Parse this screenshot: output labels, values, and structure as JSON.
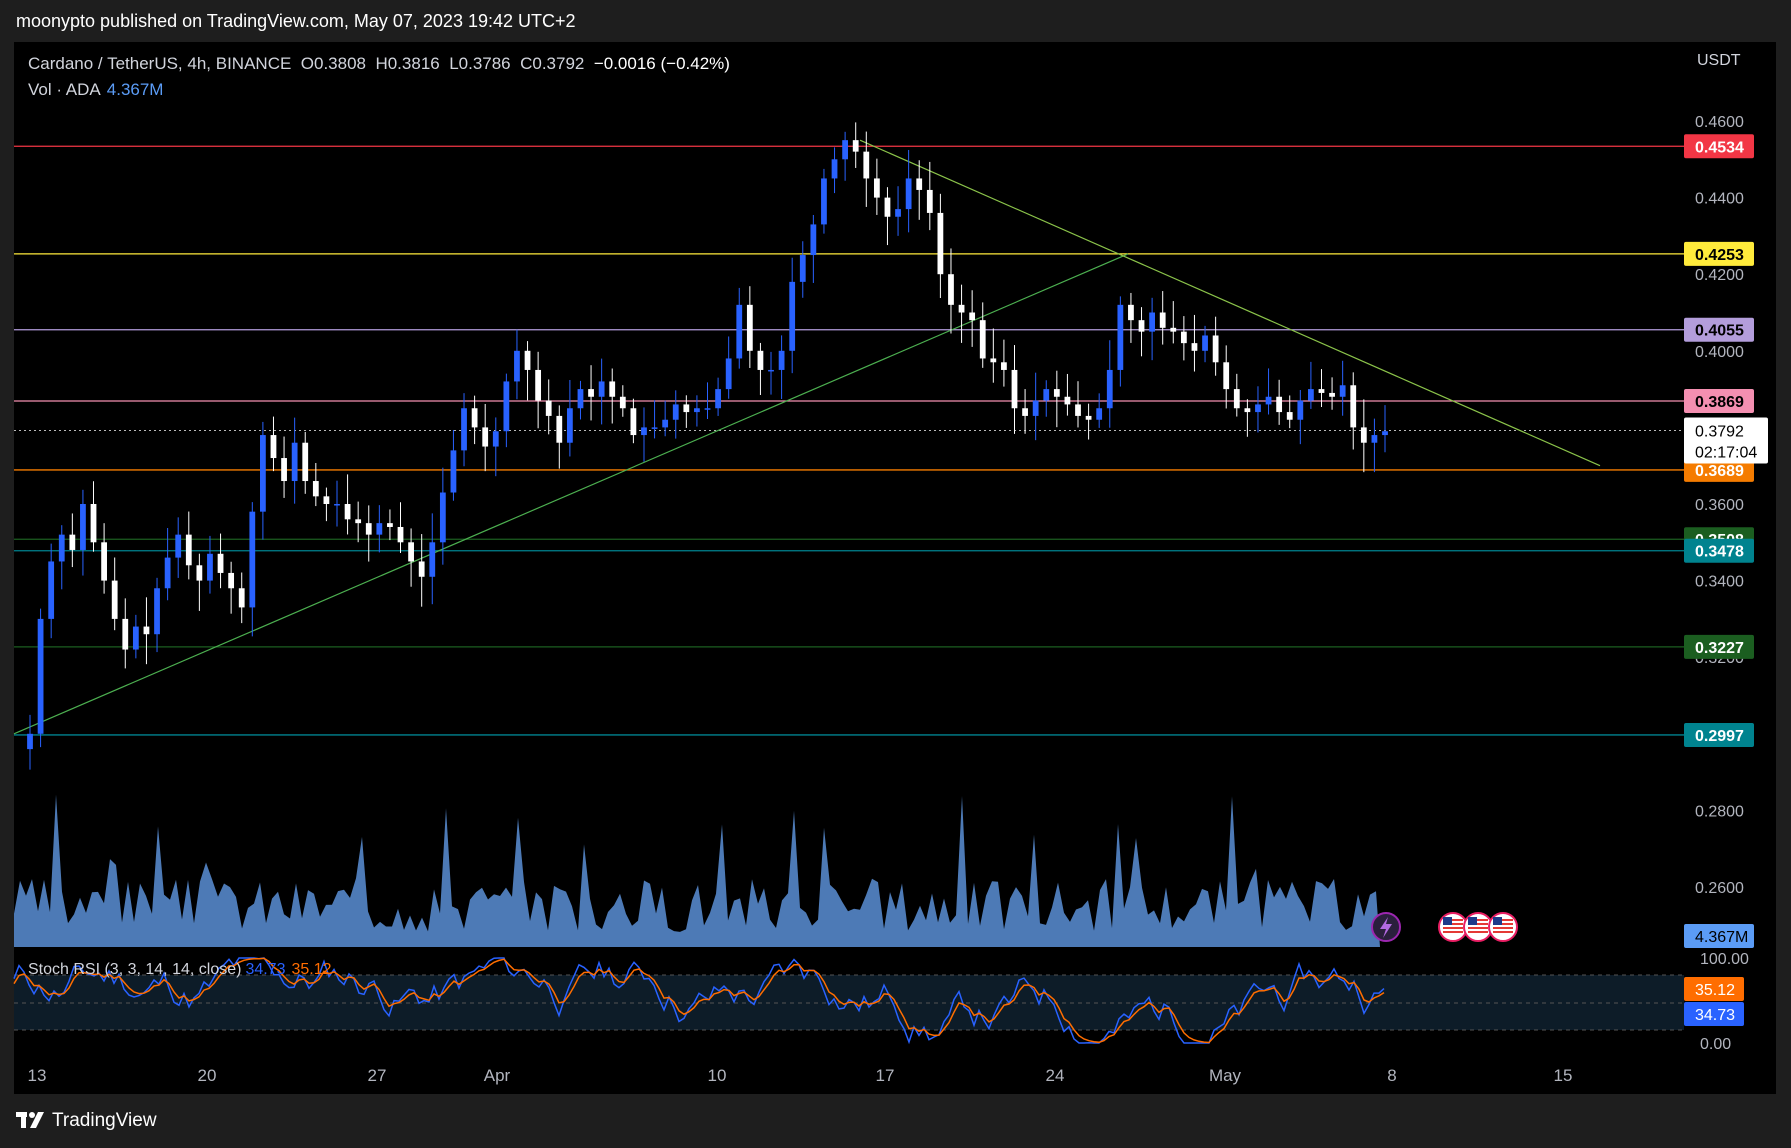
{
  "header": {
    "publisher_line": "moonypto published on TradingView.com, May 07, 2023 19:42 UTC+2"
  },
  "legend": {
    "symbol_line": "Cardano / TetherUS, 4h, BINANCE",
    "open": "O0.3808",
    "high": "H0.3816",
    "low": "L0.3786",
    "close": "C0.3792",
    "change": "−0.0016 (−0.42%)",
    "vol_label": "Vol · ADA",
    "vol_value": "4.367M"
  },
  "currency": "USDT",
  "rsi_legend": {
    "label": "Stoch RSI (3, 3, 14, 14, close)",
    "k": "34.73",
    "d": "35.12"
  },
  "footer": {
    "brand": "TradingView"
  },
  "chart_data": {
    "type": "candlestick",
    "price_axis": {
      "ticks": [
        "0.4600",
        "0.4400",
        "0.4200",
        "0.4000",
        "0.3600",
        "0.3400",
        "0.3200",
        "0.2800",
        "0.2600"
      ],
      "ylim": [
        0.25,
        0.47
      ]
    },
    "time_axis": {
      "ticks": [
        "13",
        "20",
        "27",
        "Apr",
        "10",
        "17",
        "24",
        "May",
        "8",
        "15"
      ]
    },
    "horizontal_levels": [
      {
        "price": "0.4534",
        "color": "#f23645",
        "text": "#ffffff"
      },
      {
        "price": "0.4253",
        "color": "#ffeb3b",
        "text": "#000000"
      },
      {
        "price": "0.4055",
        "color": "#b39ddb",
        "text": "#000000"
      },
      {
        "price": "0.3869",
        "color": "#f48fb1",
        "text": "#000000"
      },
      {
        "price": "0.3689",
        "color": "#f57c00",
        "text": "#ffffff"
      },
      {
        "price": "0.3508",
        "color": "#1b5e20",
        "text": "#ffffff"
      },
      {
        "price": "0.3478",
        "color": "#00838f",
        "text": "#ffffff"
      },
      {
        "price": "0.3227",
        "color": "#1b5e20",
        "text": "#ffffff"
      },
      {
        "price": "0.2997",
        "color": "#00838f",
        "text": "#ffffff"
      }
    ],
    "last_price": {
      "price": "0.3792",
      "countdown": "02:17:04"
    },
    "volume_last": "4.367M",
    "rsi_axis": {
      "ticks": [
        "100.00",
        "0.00"
      ],
      "k_badge": "34.73",
      "d_badge": "35.12"
    },
    "price_series": [
      0.3,
      0.33,
      0.345,
      0.352,
      0.348,
      0.36,
      0.35,
      0.34,
      0.33,
      0.322,
      0.328,
      0.326,
      0.338,
      0.346,
      0.352,
      0.344,
      0.34,
      0.347,
      0.342,
      0.338,
      0.333,
      0.358,
      0.378,
      0.372,
      0.366,
      0.376,
      0.366,
      0.362,
      0.36,
      0.36,
      0.356,
      0.355,
      0.352,
      0.355,
      0.354,
      0.35,
      0.345,
      0.341,
      0.35,
      0.363,
      0.374,
      0.385,
      0.38,
      0.375,
      0.379,
      0.392,
      0.4,
      0.395,
      0.387,
      0.383,
      0.376,
      0.385,
      0.39,
      0.388,
      0.392,
      0.388,
      0.385,
      0.378,
      0.38,
      0.38,
      0.382,
      0.386,
      0.384,
      0.385,
      0.385,
      0.39,
      0.398,
      0.412,
      0.4,
      0.395,
      0.395,
      0.4,
      0.418,
      0.425,
      0.433,
      0.445,
      0.45,
      0.455,
      0.452,
      0.445,
      0.44,
      0.435,
      0.437,
      0.445,
      0.442,
      0.436,
      0.42,
      0.412,
      0.41,
      0.408,
      0.398,
      0.397,
      0.395,
      0.385,
      0.383,
      0.387,
      0.39,
      0.388,
      0.386,
      0.383,
      0.382,
      0.385,
      0.395,
      0.412,
      0.408,
      0.405,
      0.41,
      0.406,
      0.405,
      0.402,
      0.4,
      0.404,
      0.397,
      0.39,
      0.385,
      0.384,
      0.386,
      0.388,
      0.384,
      0.382,
      0.387,
      0.39,
      0.389,
      0.388,
      0.391,
      0.38,
      0.376,
      0.378,
      0.379
    ],
    "trendlines": [
      {
        "from": {
          "x": "13",
          "price": 0.3
        },
        "to": {
          "x": "Apr 26",
          "price": 0.4253
        }
      },
      {
        "from": {
          "x": "Apr 14",
          "price": 0.455
        },
        "to": {
          "x": "May 10",
          "price": 0.37
        }
      }
    ]
  }
}
